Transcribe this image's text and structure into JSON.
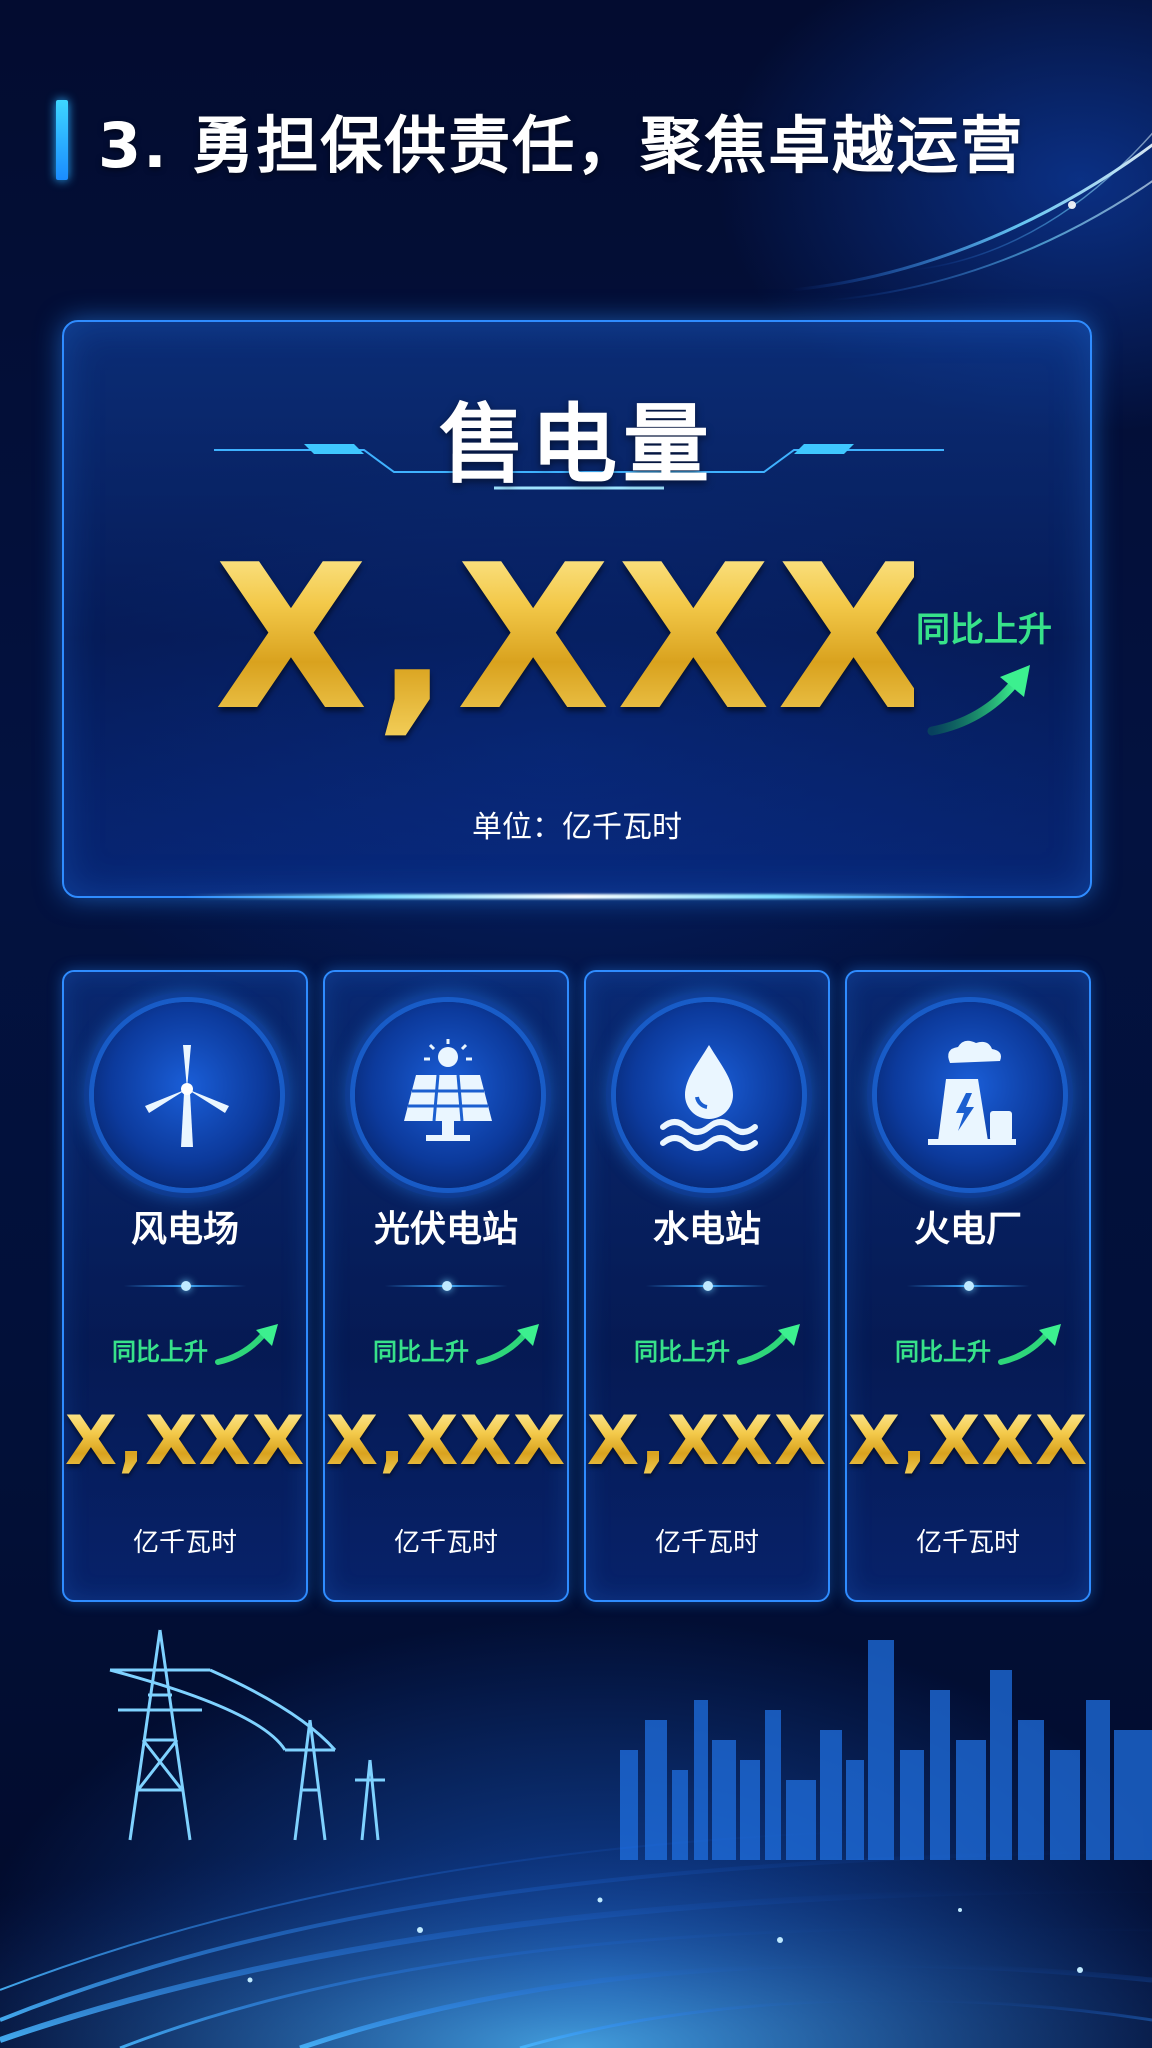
{
  "header": {
    "title": "3. 勇担保供责任，聚焦卓越运营"
  },
  "main": {
    "title": "售电量",
    "value": "X,XXX",
    "trend": "同比上升",
    "unit": "单位：亿千瓦时"
  },
  "plants": [
    {
      "name": "风电场",
      "icon": "wind-turbine-icon",
      "trend": "同比上升",
      "value": "X,XXX",
      "unit": "亿千瓦时"
    },
    {
      "name": "光伏电站",
      "icon": "solar-panel-icon",
      "trend": "同比上升",
      "value": "X,XXX",
      "unit": "亿千瓦时"
    },
    {
      "name": "水电站",
      "icon": "water-drop-icon",
      "trend": "同比上升",
      "value": "X,XXX",
      "unit": "亿千瓦时"
    },
    {
      "name": "火电厂",
      "icon": "power-plant-icon",
      "trend": "同比上升",
      "value": "X,XXX",
      "unit": "亿千瓦时"
    }
  ],
  "colors": {
    "background": "#031240",
    "accent_blue": "#2f8cff",
    "gold": "#f3c94a",
    "trend_green": "#37e28a"
  }
}
